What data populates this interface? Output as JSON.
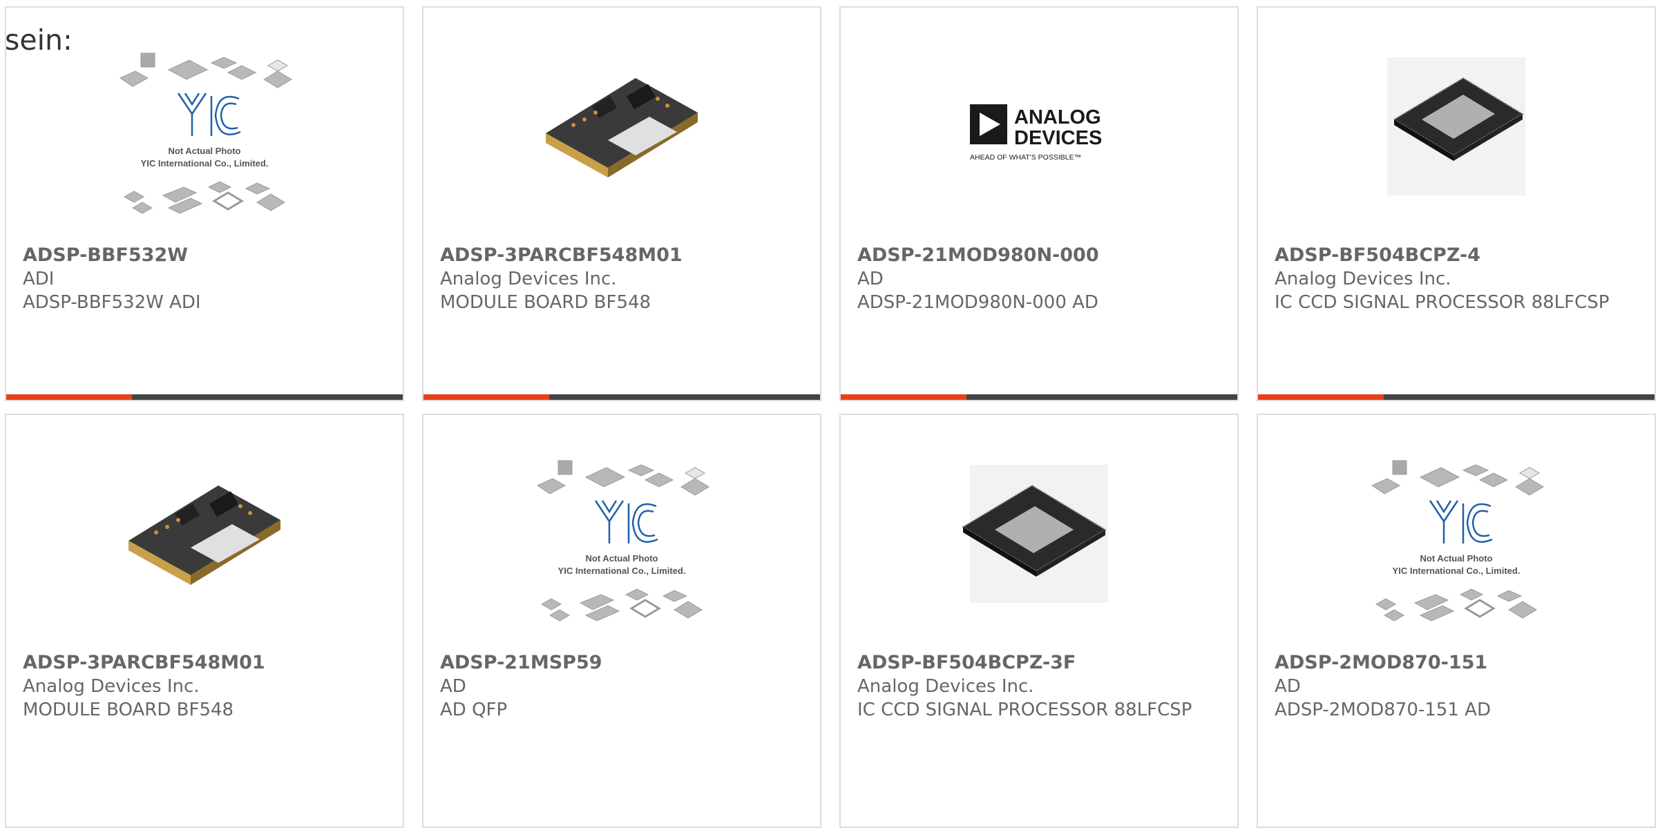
{
  "intro_text": "sein:",
  "products": [
    {
      "part": "ADSP-BBF532W",
      "maker": "ADI",
      "desc": "ADSP-BBF532W ADI",
      "image": "yic-placeholder-image",
      "image_caption_1": "Not Actual Photo",
      "image_caption_2": "YIC International Co., Limited."
    },
    {
      "part": "ADSP-3PARCBF548M01",
      "maker": "Analog Devices Inc.",
      "desc": "MODULE BOARD BF548",
      "image": "module-board-image"
    },
    {
      "part": "ADSP-21MOD980N-000",
      "maker": "AD",
      "desc": "ADSP-21MOD980N-000 AD",
      "image": "analog-devices-logo",
      "logo_line_1": "ANALOG",
      "logo_line_2": "DEVICES",
      "logo_tagline": "AHEAD OF WHAT'S POSSIBLE™"
    },
    {
      "part": "ADSP-BF504BCPZ-4",
      "maker": "Analog Devices Inc.",
      "desc": "IC CCD SIGNAL PROCESSOR 88LFCSP",
      "image": "lfcsp-chip-image"
    },
    {
      "part": "ADSP-3PARCBF548M01",
      "maker": "Analog Devices Inc.",
      "desc": "MODULE BOARD BF548",
      "image": "module-board-image"
    },
    {
      "part": "ADSP-21MSP59",
      "maker": "AD",
      "desc": "AD QFP",
      "image": "yic-placeholder-image",
      "image_caption_1": "Not Actual Photo",
      "image_caption_2": "YIC International Co., Limited."
    },
    {
      "part": "ADSP-BF504BCPZ-3F",
      "maker": "Analog Devices Inc.",
      "desc": "IC CCD SIGNAL PROCESSOR 88LFCSP",
      "image": "lfcsp-chip-image"
    },
    {
      "part": "ADSP-2MOD870-151",
      "maker": "AD",
      "desc": "ADSP-2MOD870-151 AD",
      "image": "yic-placeholder-image",
      "image_caption_1": "Not Actual Photo",
      "image_caption_2": "YIC International Co., Limited."
    }
  ],
  "colors": {
    "accent": "#e8401c",
    "bar": "#444444",
    "border": "#dddddd",
    "text": "#666666",
    "logo_blue": "#1f5fa8"
  }
}
